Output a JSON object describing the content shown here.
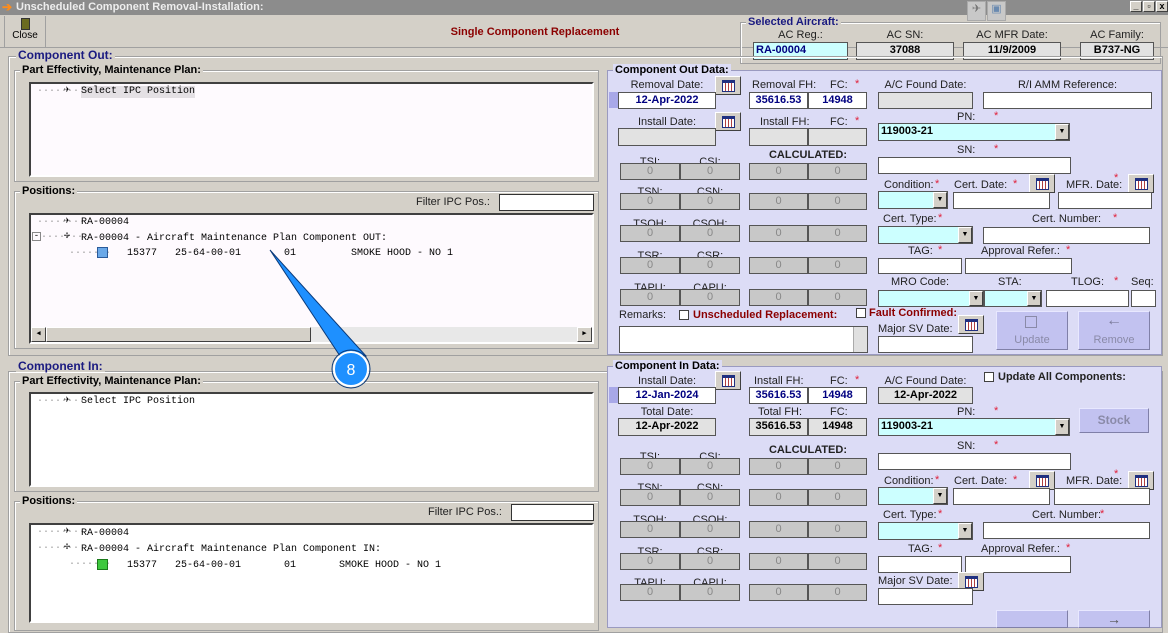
{
  "window": {
    "title": "Unscheduled Component Removal-Installation:",
    "minimize": "_",
    "restore": "▫",
    "close": "x"
  },
  "toolbar": {
    "close_label": "Close",
    "heading": "Single Component Replacement"
  },
  "selected_aircraft": {
    "title": "Selected Aircraft:",
    "ac_reg_label": "AC Reg.:",
    "ac_reg": "RA-00004",
    "ac_sn_label": "AC SN:",
    "ac_sn": "37088",
    "mfr_date_label": "AC MFR Date:",
    "mfr_date": "11/9/2009",
    "family_label": "AC Family:",
    "family": "B737-NG"
  },
  "component_out": {
    "title": "Component Out:",
    "part_effectivity": {
      "title": "Part Effectivity, Maintenance Plan:",
      "item": "Select IPC Position"
    },
    "positions": {
      "title": "Positions:",
      "filter_label": "Filter IPC Pos.:",
      "filter_value": "",
      "aircraft": "RA-00004",
      "plan": "RA-00004 - Aircraft Maintenance Plan Component OUT:",
      "item": {
        "id": "15377",
        "ata": "25-64-00-01",
        "pos": "01",
        "desc": "SMOKE HOOD - NO 1"
      }
    }
  },
  "component_in": {
    "title": "Component In:",
    "part_effectivity": {
      "title": "Part Effectivity, Maintenance Plan:",
      "item": "Select IPC Position"
    },
    "positions": {
      "title": "Positions:",
      "filter_label": "Filter IPC Pos.:",
      "filter_value": "",
      "aircraft": "RA-00004",
      "plan": "RA-00004 - Aircraft Maintenance Plan Component IN:",
      "item": {
        "id": "15377",
        "ata": "25-64-00-01",
        "pos": "01",
        "desc": "SMOKE HOOD - NO 1"
      }
    }
  },
  "labels": {
    "removal_date": "Removal Date:",
    "removal_fh": "Removal FH:",
    "fc": "FC:",
    "ac_found_date": "A/C Found Date:",
    "ri_amm": "R/I AMM Reference:",
    "install_date": "Install Date:",
    "install_fh": "Install  FH:",
    "pn": "PN:",
    "sn": "SN:",
    "calculated": "CALCULATED:",
    "condition": "Condition:",
    "cert_date": "Cert. Date:",
    "mfr_date": "MFR. Date:",
    "cert_type": "Cert. Type:",
    "cert_number": "Cert. Number:",
    "tag": "TAG:",
    "approval": "Approval Refer.:",
    "mro_code": "MRO Code:",
    "sta": "STA:",
    "tlog": "TLOG:",
    "seq": "Seq:",
    "remarks": "Remarks:",
    "unscheduled": "Unscheduled Replacement:",
    "fault": "Fault Confirmed:",
    "major_sv": "Major SV Date:",
    "total_date": "Total Date:",
    "total_fh": "Total FH:",
    "update_all": "Update All Components:",
    "required": "*",
    "counter_rows": [
      [
        "TSI:",
        "CSI:"
      ],
      [
        "TSN:",
        "CSN:"
      ],
      [
        "TSOH:",
        "CSOH:"
      ],
      [
        "TSR:",
        "CSR:"
      ],
      [
        "TAPU:",
        "CAPU:"
      ]
    ]
  },
  "out_data": {
    "title": "Component Out Data:",
    "removal_date": "12-Apr-2022",
    "removal_fh": "35616.53",
    "removal_fc": "14948",
    "install_date": "",
    "install_fh": "",
    "install_fc": "",
    "ac_found_date": "",
    "ri_amm": "",
    "pn": "119003-21",
    "sn": "",
    "condition": "",
    "cert_date": "",
    "mfr_date": "",
    "cert_type": "",
    "cert_number": "",
    "tag": "",
    "approval": "",
    "mro_code": "",
    "sta": "",
    "tlog": "",
    "seq": "",
    "remarks": "",
    "major_sv": "",
    "unscheduled_checked": false,
    "fault_checked": false,
    "counters": [
      [
        "0",
        "0",
        "0",
        "0"
      ],
      [
        "0",
        "0",
        "0",
        "0"
      ],
      [
        "0",
        "0",
        "0",
        "0"
      ],
      [
        "0",
        "0",
        "0",
        "0"
      ],
      [
        "0",
        "0",
        "0",
        "0"
      ]
    ],
    "update_label": "Update",
    "remove_label": "Remove"
  },
  "in_data": {
    "title": "Component In Data:",
    "install_date": "12-Jan-2024",
    "install_fh": "35616.53",
    "install_fc": "14948",
    "ac_found_date": "12-Apr-2022",
    "total_date": "12-Apr-2022",
    "total_fh": "35616.53",
    "total_fc": "14948",
    "pn": "119003-21",
    "sn": "",
    "condition": "",
    "cert_date": "",
    "mfr_date": "",
    "cert_type": "",
    "cert_number": "",
    "tag": "",
    "approval": "",
    "major_sv": "",
    "update_all_checked": false,
    "stock_label": "Stock",
    "counters": [
      [
        "0",
        "0",
        "0",
        "0"
      ],
      [
        "0",
        "0",
        "0",
        "0"
      ],
      [
        "0",
        "0",
        "0",
        "0"
      ],
      [
        "0",
        "0",
        "0",
        "0"
      ],
      [
        "0",
        "0",
        "0",
        "0"
      ]
    ]
  },
  "callout": {
    "number": "8",
    "color": "#1e90ff"
  },
  "colors": {
    "heading": "#8b0000",
    "group_title": "#1a1a80",
    "panel": "#dcdcf6",
    "combo": "#ccffff"
  }
}
